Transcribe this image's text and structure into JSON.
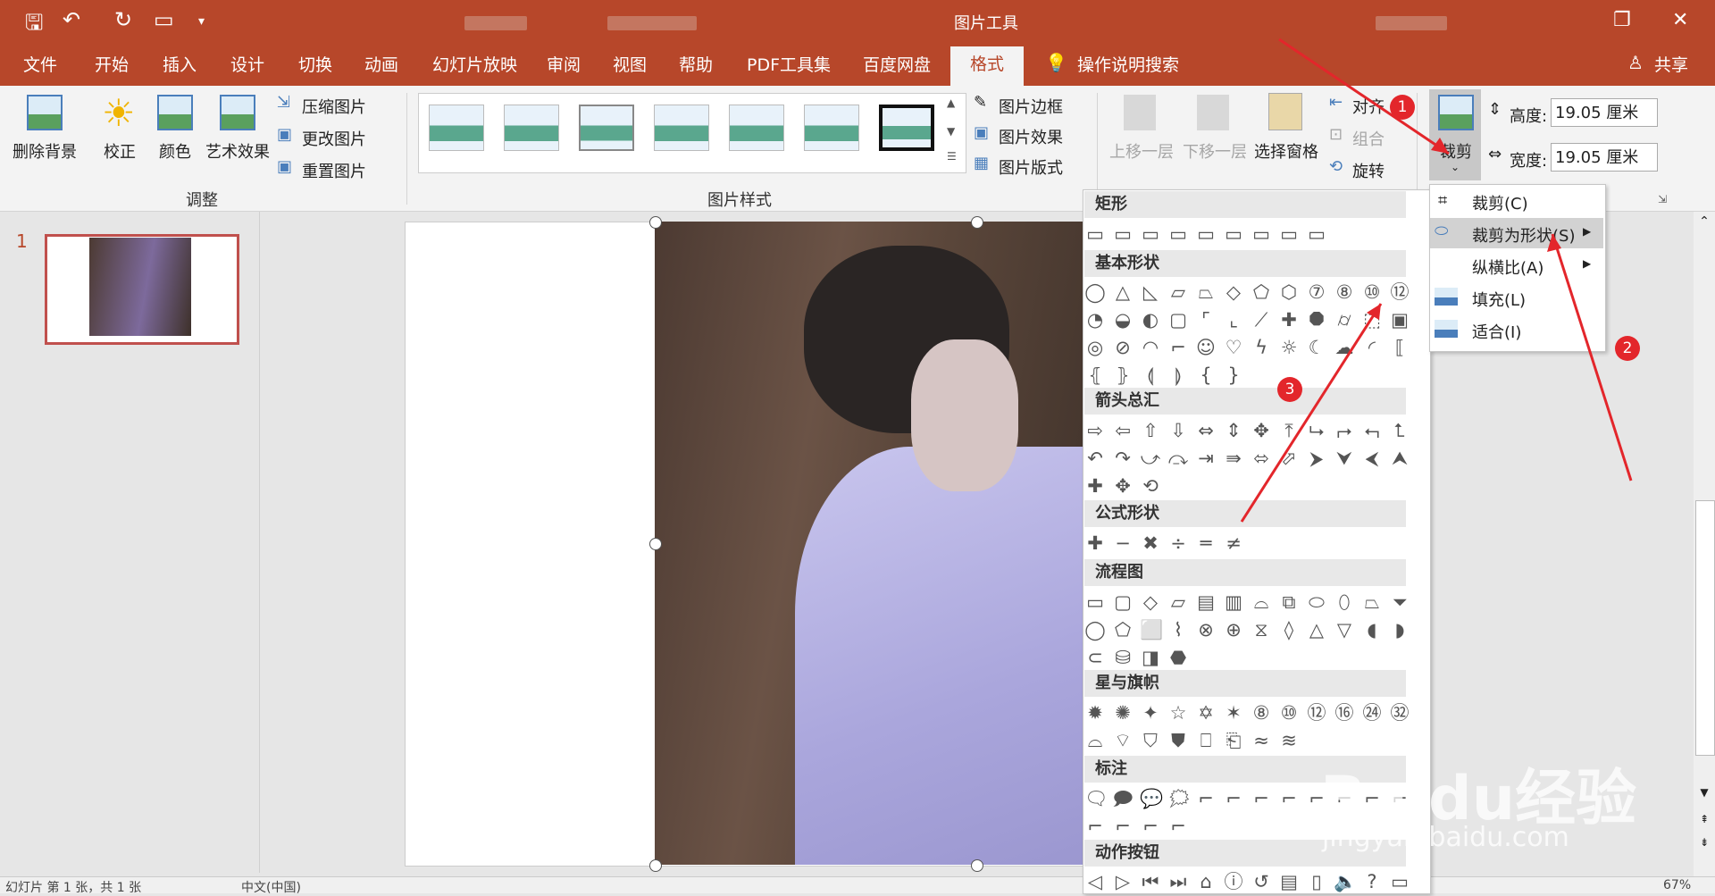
{
  "title_bar": {
    "context_title": "图片工具",
    "qat_icons": [
      "save-icon",
      "undo-icon",
      "redo-icon",
      "present-icon",
      "customize-icon"
    ]
  },
  "tabs": [
    "文件",
    "开始",
    "插入",
    "设计",
    "切换",
    "动画",
    "幻灯片放映",
    "审阅",
    "视图",
    "帮助",
    "PDF工具集",
    "百度网盘"
  ],
  "active_tab": "格式",
  "tell_me": "操作说明搜索",
  "share": "共享",
  "ribbon": {
    "adjust": {
      "remove_bg": "删除背景",
      "corrections": "校正",
      "color": "颜色",
      "artistic": "艺术效果",
      "compress": "压缩图片",
      "change": "更改图片",
      "reset": "重置图片",
      "group_label": "调整"
    },
    "styles": {
      "border": "图片边框",
      "effects": "图片效果",
      "layout": "图片版式",
      "group_label": "图片样式"
    },
    "arrange": {
      "bring_forward": "上移一层",
      "send_backward": "下移一层",
      "selection_pane": "选择窗格",
      "align": "对齐",
      "group": "组合",
      "rotate": "旋转"
    },
    "size": {
      "crop": "裁剪",
      "height_label": "高度:",
      "height_value": "19.05 厘米",
      "width_label": "宽度:",
      "width_value": "19.05 厘米"
    }
  },
  "crop_menu": [
    "裁剪(C)",
    "裁剪为形状(S)",
    "纵横比(A)",
    "填充(L)",
    "适合(I)"
  ],
  "shapes_panel": {
    "categories": [
      "矩形",
      "基本形状",
      "箭头总汇",
      "公式形状",
      "流程图",
      "星与旗帜",
      "标注",
      "动作按钮"
    ]
  },
  "slide_number": "1",
  "annotations": [
    "1",
    "2",
    "3"
  ],
  "status": {
    "slide_info": "幻灯片 第 1 张，共 1 张",
    "lang": "中文(中国)",
    "zoom": "67%"
  },
  "watermark": {
    "brand": "Baidu经验",
    "url": "jingyan.baidu.com"
  },
  "colors": {
    "accent": "#b7472a",
    "badge": "#e3262b"
  }
}
